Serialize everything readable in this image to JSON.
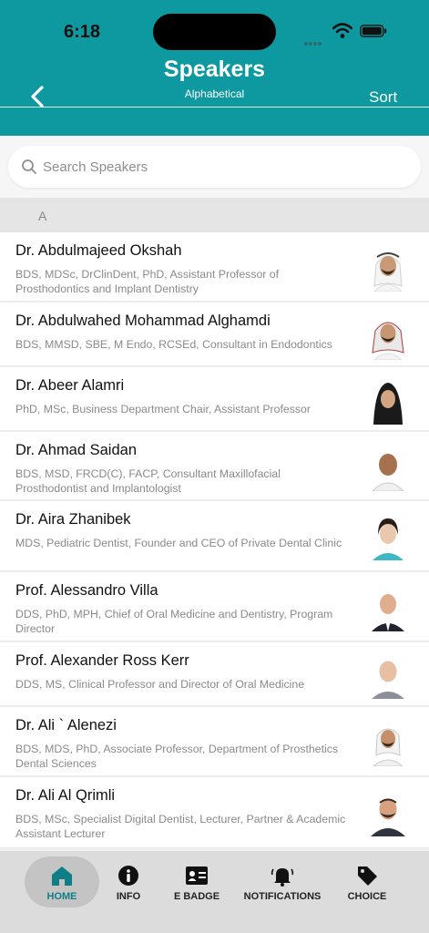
{
  "status": {
    "time": "6:18"
  },
  "header": {
    "title": "Speakers",
    "subtitle": "Alphabetical",
    "sort_label": "Sort",
    "accent_color": "#0e98a0"
  },
  "search": {
    "placeholder": "Search Speakers",
    "value": ""
  },
  "section": {
    "letter": "A"
  },
  "speakers": [
    {
      "name": "Dr. Abdulmajeed Okshah",
      "description": "BDS, MDSc, DrClinDent, PhD, Assistant Professor of Prosthodontics and Implant Dentistry"
    },
    {
      "name": "Dr. Abdulwahed Mohammad Alghamdi",
      "description": "BDS, MMSD, SBE, M Endo, RCSEd, Consultant in Endodontics"
    },
    {
      "name": "Dr. Abeer Alamri",
      "description": "PhD, MSc, Business Department Chair, Assistant Professor"
    },
    {
      "name": "Dr. Ahmad Saidan",
      "description": "BDS, MSD, FRCD(C), FACP, Consultant Maxillofacial Prosthodontist and Implantologist"
    },
    {
      "name": "Dr. Aira Zhanibek",
      "description": "MDS, Pediatric Dentist, Founder and CEO of Private Dental Clinic"
    },
    {
      "name": "Prof. Alessandro Villa",
      "description": "DDS, PhD, MPH, Chief of Oral Medicine and Dentistry, Program Director"
    },
    {
      "name": "Prof. Alexander Ross Kerr",
      "description": "DDS, MS, Clinical Professor and Director of Oral Medicine"
    },
    {
      "name": "Dr. Ali ` Alenezi",
      "description": "BDS, MDS, PhD, Associate Professor, Department of Prosthetics Dental Sciences"
    },
    {
      "name": "Dr. Ali Al Qrimli",
      "description": "BDS, MSc, Specialist Digital Dentist, Lecturer, Partner & Academic Assistant Lecturer"
    }
  ],
  "tabs": [
    {
      "label": "HOME",
      "icon": "home-icon",
      "active": true
    },
    {
      "label": "INFO",
      "icon": "info-icon",
      "active": false
    },
    {
      "label": "E BADGE",
      "icon": "badge-icon",
      "active": false
    },
    {
      "label": "NOTIFICATIONS",
      "icon": "bell-icon",
      "active": false
    },
    {
      "label": "CHOICE",
      "icon": "tag-icon",
      "active": false
    }
  ]
}
